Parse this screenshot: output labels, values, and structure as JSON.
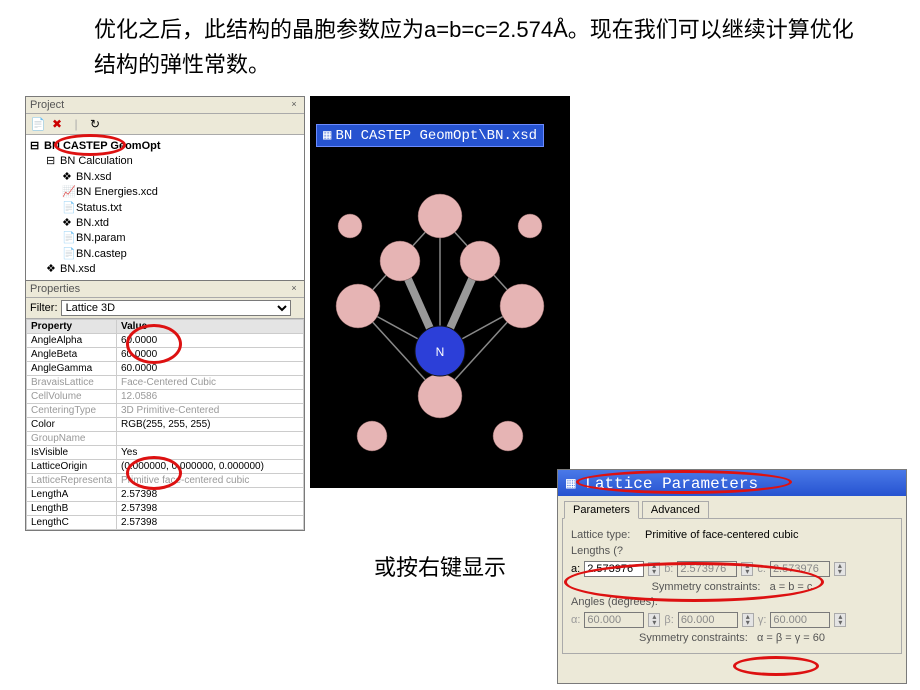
{
  "intro_text": "优化之后，此结构的晶胞参数应为a=b=c=2.574Å。现在我们可以继续计算优化结构的弹性常数。",
  "mid_text": "或按右键显示",
  "project": {
    "title": "Project",
    "toolbar_icons": [
      "new-doc-icon",
      "close-icon",
      "refresh-icon"
    ],
    "tree": [
      {
        "level": 0,
        "icon": "⊟",
        "label": "BN CASTEP GeomOpt",
        "bold": true
      },
      {
        "level": 1,
        "icon": "⊟",
        "label": "BN Calculation"
      },
      {
        "level": 2,
        "icon": "❖",
        "label": "BN.xsd"
      },
      {
        "level": 2,
        "icon": "📈",
        "label": "BN Energies.xcd"
      },
      {
        "level": 2,
        "icon": "📄",
        "label": "Status.txt"
      },
      {
        "level": 2,
        "icon": "❖",
        "label": "BN.xtd"
      },
      {
        "level": 2,
        "icon": "📄",
        "label": "BN.param"
      },
      {
        "level": 2,
        "icon": "📄",
        "label": "BN.castep"
      },
      {
        "level": 1,
        "icon": "❖",
        "label": "BN.xsd"
      }
    ]
  },
  "properties": {
    "title": "Properties",
    "filter_label": "Filter:",
    "filter_value": "Lattice 3D",
    "headers": {
      "prop": "Property",
      "val": "Value"
    },
    "rows": [
      {
        "prop": "AngleAlpha",
        "val": "60.0000",
        "gray": false
      },
      {
        "prop": "AngleBeta",
        "val": "60.0000",
        "gray": false
      },
      {
        "prop": "AngleGamma",
        "val": "60.0000",
        "gray": false
      },
      {
        "prop": "BravaisLattice",
        "val": "Face-Centered Cubic",
        "gray": true
      },
      {
        "prop": "CellVolume",
        "val": "12.0586",
        "gray": true
      },
      {
        "prop": "CenteringType",
        "val": "3D Primitive-Centered",
        "gray": true
      },
      {
        "prop": "Color",
        "val": "RGB(255, 255, 255)",
        "gray": false
      },
      {
        "prop": "GroupName",
        "val": "",
        "gray": true
      },
      {
        "prop": "IsVisible",
        "val": "Yes",
        "gray": false
      },
      {
        "prop": "LatticeOrigin",
        "val": "(0.000000, 0.000000, 0.000000)",
        "gray": false
      },
      {
        "prop": "LatticeRepresenta",
        "val": "Primitive face-centered cubic",
        "gray": true
      },
      {
        "prop": "LengthA",
        "val": "2.57398",
        "gray": false
      },
      {
        "prop": "LengthB",
        "val": "2.57398",
        "gray": false
      },
      {
        "prop": "LengthC",
        "val": "2.57398",
        "gray": false
      }
    ]
  },
  "viewer": {
    "title": "BN CASTEP GeomOpt\\BN.xsd",
    "center_atom_label": "N"
  },
  "lattice": {
    "title": "Lattice Parameters",
    "tabs": {
      "params": "Parameters",
      "adv": "Advanced"
    },
    "type_label": "Lattice type:",
    "type_value": "Primitive of face-centered cubic",
    "lengths_label": "Lengths (?",
    "a": "2.573976",
    "b": "2.573976",
    "c": "2.573976",
    "length_labels": {
      "a": "a:",
      "b": "b:",
      "c": "c:"
    },
    "len_constraint_label": "Symmetry constraints:",
    "len_constraint": "a = b = c",
    "angles_label": "Angles (degrees):",
    "angle_labels": {
      "a": "α:",
      "b": "β:",
      "c": "γ:"
    },
    "alpha": "60.000",
    "beta": "60.000",
    "gamma": "60.000",
    "ang_constraint_label": "Symmetry constraints:",
    "ang_constraint": "α = β = γ = 60"
  }
}
